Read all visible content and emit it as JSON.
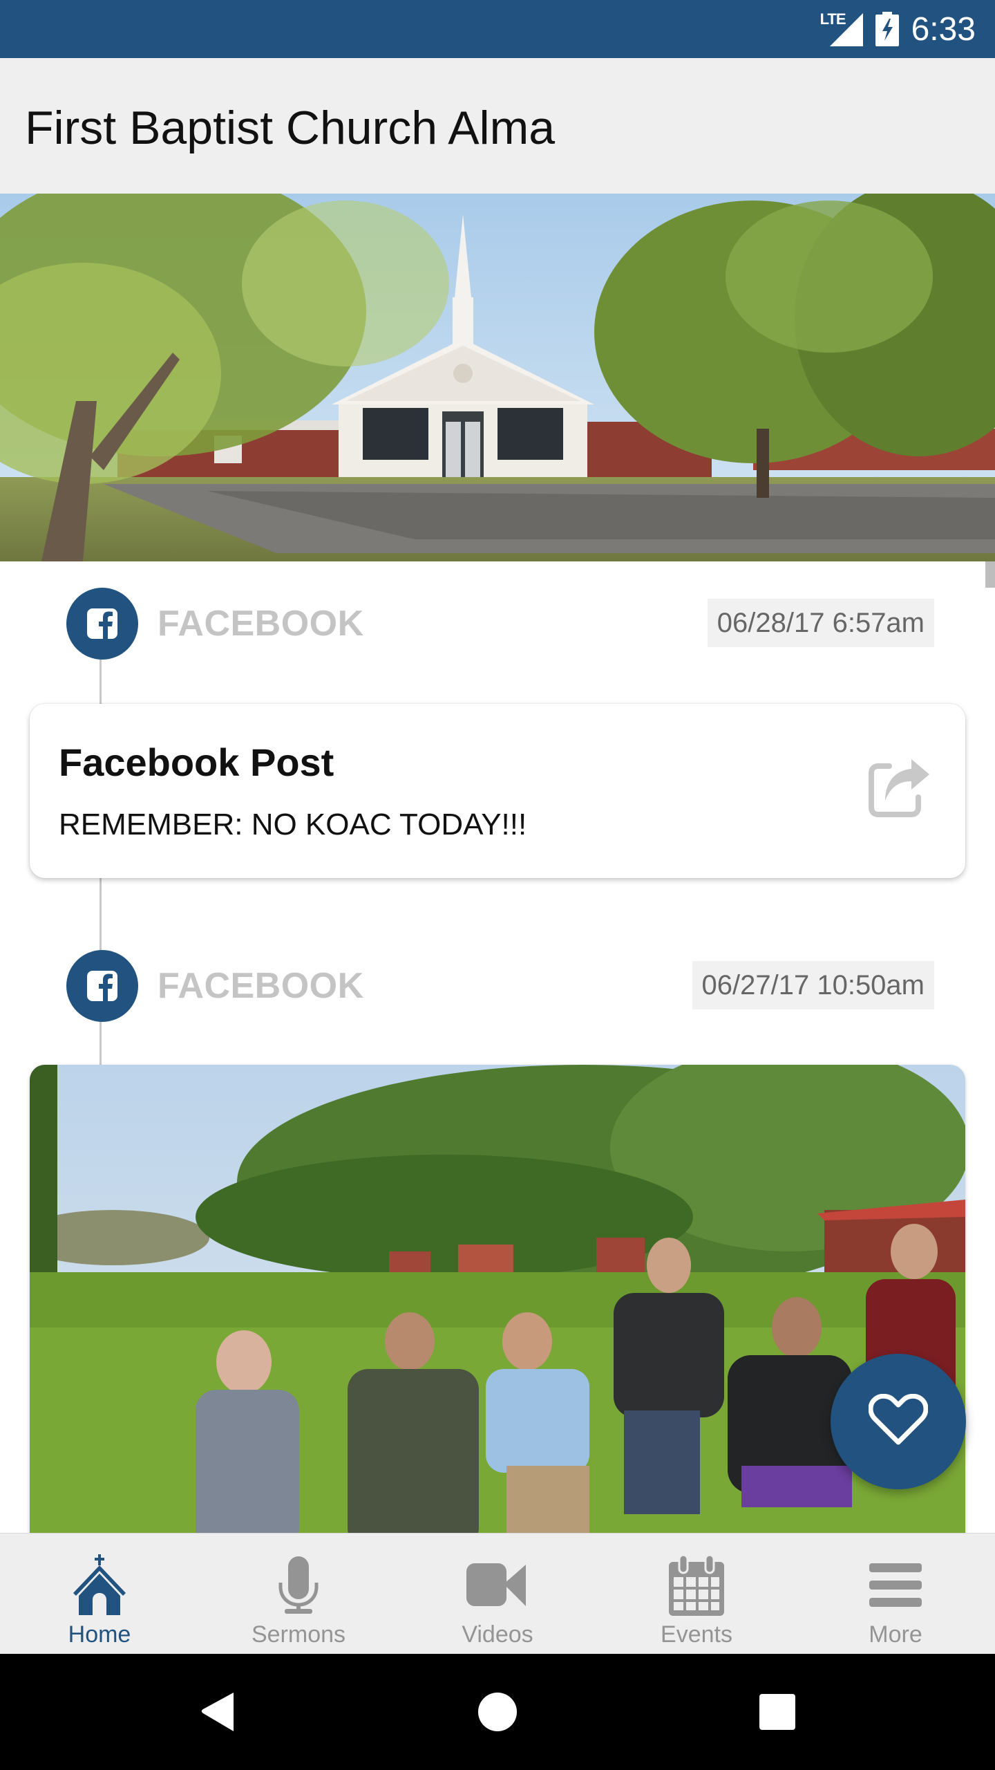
{
  "status_bar": {
    "network": "LTE",
    "time": "6:33",
    "icons": [
      "lte-signal-icon",
      "battery-charging-icon"
    ]
  },
  "app_bar": {
    "title": "First Baptist Church Alma"
  },
  "hero": {
    "image": "church-building-photo"
  },
  "feed": {
    "items": [
      {
        "source": "FACEBOOK",
        "source_icon": "facebook-icon",
        "timestamp": "06/28/17 6:57am",
        "type": "text",
        "title": "Facebook Post",
        "body": "REMEMBER: NO KOAC TODAY!!!",
        "action_icon": "share-icon"
      },
      {
        "source": "FACEBOOK",
        "source_icon": "facebook-icon",
        "timestamp": "06/27/17 10:50am",
        "type": "photo",
        "image": "group-photo-outdoors"
      }
    ]
  },
  "fab": {
    "icon": "heart-icon"
  },
  "bottom_nav": {
    "items": [
      {
        "label": "Home",
        "icon": "church-home-icon",
        "active": true
      },
      {
        "label": "Sermons",
        "icon": "microphone-icon",
        "active": false
      },
      {
        "label": "Videos",
        "icon": "video-camera-icon",
        "active": false
      },
      {
        "label": "Events",
        "icon": "calendar-icon",
        "active": false
      },
      {
        "label": "More",
        "icon": "menu-icon",
        "active": false
      }
    ]
  },
  "colors": {
    "primary": "#225380",
    "inactive": "#949494",
    "source_label": "#c4c4c4"
  }
}
